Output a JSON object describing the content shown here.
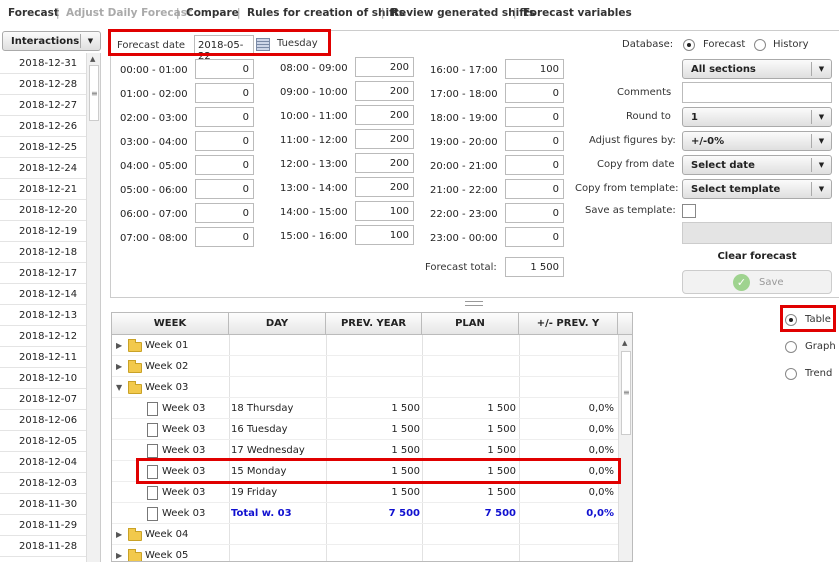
{
  "nav": {
    "forecast": "Forecast",
    "adjust_daily": "Adjust Daily Forecast",
    "compare": "Compare",
    "rules": "Rules for creation of shifts",
    "review": "Review generated shifts",
    "variables": "Forecast variables"
  },
  "interactions": {
    "label": "Interactions",
    "dates": [
      "2018-12-31",
      "2018-12-28",
      "2018-12-27",
      "2018-12-26",
      "2018-12-25",
      "2018-12-24",
      "2018-12-21",
      "2018-12-20",
      "2018-12-19",
      "2018-12-18",
      "2018-12-17",
      "2018-12-14",
      "2018-12-13",
      "2018-12-12",
      "2018-12-11",
      "2018-12-10",
      "2018-12-07",
      "2018-12-06",
      "2018-12-05",
      "2018-12-04",
      "2018-12-03",
      "2018-11-30",
      "2018-11-29",
      "2018-11-28"
    ]
  },
  "forecast_date": {
    "label": "Forecast date",
    "value": "2018-05-22",
    "weekday": "Tuesday"
  },
  "hours": {
    "col1": [
      {
        "label": "00:00 - 01:00",
        "value": "0"
      },
      {
        "label": "01:00 - 02:00",
        "value": "0"
      },
      {
        "label": "02:00 - 03:00",
        "value": "0"
      },
      {
        "label": "03:00 - 04:00",
        "value": "0"
      },
      {
        "label": "04:00 - 05:00",
        "value": "0"
      },
      {
        "label": "05:00 - 06:00",
        "value": "0"
      },
      {
        "label": "06:00 - 07:00",
        "value": "0"
      },
      {
        "label": "07:00 - 08:00",
        "value": "0"
      }
    ],
    "col2": [
      {
        "label": "08:00 - 09:00",
        "value": "200"
      },
      {
        "label": "09:00 - 10:00",
        "value": "200"
      },
      {
        "label": "10:00 - 11:00",
        "value": "200"
      },
      {
        "label": "11:00 - 12:00",
        "value": "200"
      },
      {
        "label": "12:00 - 13:00",
        "value": "200"
      },
      {
        "label": "13:00 - 14:00",
        "value": "200"
      },
      {
        "label": "14:00 - 15:00",
        "value": "100"
      },
      {
        "label": "15:00 - 16:00",
        "value": "100"
      }
    ],
    "col3": [
      {
        "label": "16:00 - 17:00",
        "value": "100"
      },
      {
        "label": "17:00 - 18:00",
        "value": "0"
      },
      {
        "label": "18:00 - 19:00",
        "value": "0"
      },
      {
        "label": "19:00 - 20:00",
        "value": "0"
      },
      {
        "label": "20:00 - 21:00",
        "value": "0"
      },
      {
        "label": "21:00 - 22:00",
        "value": "0"
      },
      {
        "label": "22:00 - 23:00",
        "value": "0"
      },
      {
        "label": "23:00 - 00:00",
        "value": "0"
      }
    ],
    "total_label": "Forecast total:",
    "total_value": "1 500"
  },
  "settings": {
    "database_label": "Database:",
    "db_forecast": "Forecast",
    "db_history": "History",
    "sections_value": "All sections",
    "comments_label": "Comments",
    "round_label": "Round to",
    "round_value": "1",
    "adjust_label": "Adjust figures by:",
    "adjust_value": "+/-0%",
    "copy_date_label": "Copy from date",
    "copy_date_value": "Select date",
    "copy_template_label": "Copy from template:",
    "copy_template_value": "Select template",
    "save_template_label": "Save as template:",
    "clear_label": "Clear forecast",
    "save_label": "Save"
  },
  "view_options": {
    "table": "Table",
    "graph": "Graph",
    "trend": "Trend"
  },
  "grid": {
    "headers": [
      "WEEK",
      "DAY",
      "PREV. YEAR",
      "PLAN",
      "+/- PREV. Y"
    ],
    "rows": [
      {
        "type": "folder",
        "state": "closed",
        "week": "Week 01",
        "day": "",
        "prev": "",
        "plan": "",
        "diff": ""
      },
      {
        "type": "folder",
        "state": "closed",
        "week": "Week 02",
        "day": "",
        "prev": "",
        "plan": "",
        "diff": ""
      },
      {
        "type": "folder",
        "state": "open",
        "week": "Week 03",
        "day": "",
        "prev": "",
        "plan": "",
        "diff": ""
      },
      {
        "type": "doc",
        "week": "Week 03",
        "day": "18 Thursday",
        "prev": "1 500",
        "plan": "1 500",
        "diff": "0,0%"
      },
      {
        "type": "doc",
        "week": "Week 03",
        "day": "16 Tuesday",
        "prev": "1 500",
        "plan": "1 500",
        "diff": "0,0%"
      },
      {
        "type": "doc",
        "week": "Week 03",
        "day": "17 Wednesday",
        "prev": "1 500",
        "plan": "1 500",
        "diff": "0,0%"
      },
      {
        "type": "doc",
        "week": "Week 03",
        "day": "15 Monday",
        "prev": "1 500",
        "plan": "1 500",
        "diff": "0,0%"
      },
      {
        "type": "doc",
        "week": "Week 03",
        "day": "19 Friday",
        "prev": "1 500",
        "plan": "1 500",
        "diff": "0,0%"
      },
      {
        "type": "total",
        "week": "Week 03",
        "day": "Total w. 03",
        "prev": "7 500",
        "plan": "7 500",
        "diff": "0,0%"
      },
      {
        "type": "folder",
        "state": "closed",
        "week": "Week 04",
        "day": "",
        "prev": "",
        "plan": "",
        "diff": ""
      },
      {
        "type": "folder",
        "state": "closed",
        "week": "Week 05",
        "day": "",
        "prev": "",
        "plan": "",
        "diff": ""
      }
    ]
  },
  "colors": {
    "highlight": "#e00000",
    "total_text": "#1010d0"
  }
}
